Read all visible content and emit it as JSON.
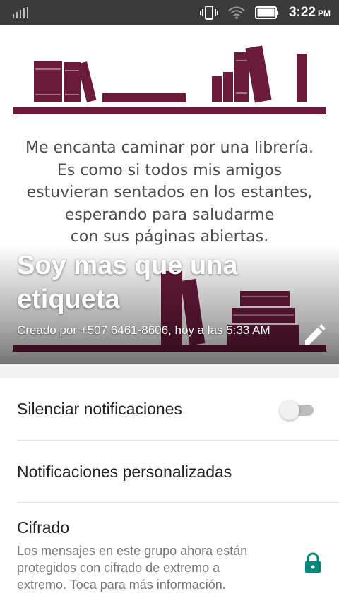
{
  "status_bar": {
    "time": "3:22",
    "ampm": "PM",
    "icons": [
      "signal-icon",
      "vibrate-icon",
      "wifi-icon",
      "battery-icon"
    ]
  },
  "header": {
    "image_quote": [
      "Me encanta caminar por una librería.",
      "Es como si todos mis amigos",
      "estuvieran sentados en los estantes,",
      "esperando para saludarme",
      "con sus páginas abiertas."
    ],
    "title": "Soy mas que una etiqueta",
    "subtitle": "Creado por +507 6461-8606, hoy a las 5:33 AM",
    "accent_color": "#6a1b3a"
  },
  "settings": {
    "mute_label": "Silenciar notificaciones",
    "mute_enabled": false,
    "custom_notifications_label": "Notificaciones personalizadas",
    "encryption_title": "Cifrado",
    "encryption_desc": "Los mensajes en este grupo ahora están protegidos con cifrado de extremo a extremo. Toca para más información.",
    "lock_color": "#00897b"
  }
}
